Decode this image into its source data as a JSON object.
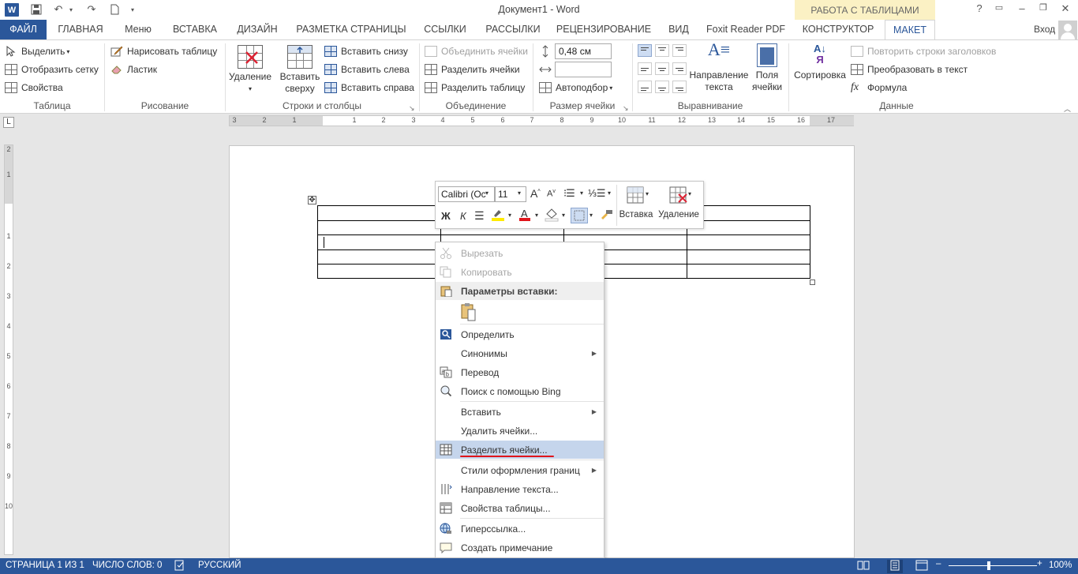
{
  "window": {
    "title": "Документ1 - Word",
    "context_group": "РАБОТА С ТАБЛИЦАМИ",
    "help": "?",
    "sign_in": "Вход"
  },
  "tabs": [
    {
      "label": "ФАЙЛ"
    },
    {
      "label": "ГЛАВНАЯ"
    },
    {
      "label": "Меню"
    },
    {
      "label": "ВСТАВКА"
    },
    {
      "label": "ДИЗАЙН"
    },
    {
      "label": "РАЗМЕТКА СТРАНИЦЫ"
    },
    {
      "label": "ССЫЛКИ"
    },
    {
      "label": "РАССЫЛКИ"
    },
    {
      "label": "РЕЦЕНЗИРОВАНИЕ"
    },
    {
      "label": "ВИД"
    },
    {
      "label": "Foxit Reader PDF"
    },
    {
      "label": "КОНСТРУКТОР"
    },
    {
      "label": "МАКЕТ"
    }
  ],
  "ribbon": {
    "table": {
      "label": "Таблица",
      "select": "Выделить",
      "show_grid": "Отобразить сетку",
      "properties": "Свойства"
    },
    "draw": {
      "label": "Рисование",
      "draw_table": "Нарисовать таблицу",
      "eraser": "Ластик"
    },
    "rows_cols": {
      "label": "Строки и столбцы",
      "delete": "Удаление",
      "insert_above_1": "Вставить",
      "insert_above_2": "сверху",
      "insert_below": "Вставить снизу",
      "insert_left": "Вставить слева",
      "insert_right": "Вставить справа"
    },
    "merge": {
      "label": "Объединение",
      "merge_cells": "Объединить ячейки",
      "split_cells": "Разделить ячейки",
      "split_table": "Разделить таблицу"
    },
    "cell_size": {
      "label": "Размер ячейки",
      "height": "0,48 см",
      "width": "",
      "autofit": "Автоподбор"
    },
    "alignment": {
      "label": "Выравнивание",
      "text_dir_1": "Направление",
      "text_dir_2": "текста",
      "margins_1": "Поля",
      "margins_2": "ячейки"
    },
    "data": {
      "label": "Данные",
      "sort": "Сортировка",
      "repeat_header": "Повторить строки заголовков",
      "convert": "Преобразовать в текст",
      "formula": "Формула"
    }
  },
  "ruler": {
    "h_numbers": [
      "3",
      "2",
      "1",
      "1",
      "2",
      "3",
      "4",
      "5",
      "6",
      "7",
      "8",
      "9",
      "10",
      "11",
      "12",
      "13",
      "14",
      "15",
      "16",
      "17"
    ],
    "v_numbers": [
      "2",
      "1",
      "1",
      "2",
      "3",
      "4",
      "5",
      "6",
      "7",
      "8",
      "9",
      "10"
    ]
  },
  "minibar": {
    "font": "Calibri (Ос",
    "size": "11",
    "bold": "Ж",
    "italic": "К",
    "insert": "Вставка",
    "delete": "Удаление"
  },
  "context_menu": {
    "cut": "Вырезать",
    "copy": "Копировать",
    "paste_options": "Параметры вставки:",
    "define": "Определить",
    "synonyms": "Синонимы",
    "translate": "Перевод",
    "bing_search": "Поиск с помощью Bing",
    "insert": "Вставить",
    "delete_cells": "Удалить ячейки...",
    "split_cells": "Разделить ячейки...",
    "border_styles": "Стили оформления границ",
    "text_direction": "Направление текста...",
    "table_properties": "Свойства таблицы...",
    "hyperlink": "Гиперссылка...",
    "add_comment": "Создать примечание"
  },
  "status": {
    "page": "СТРАНИЦА 1 ИЗ 1",
    "words": "ЧИСЛО СЛОВ: 0",
    "language": "РУССКИЙ",
    "zoom": "100%"
  },
  "colors": {
    "accent": "#2b579a",
    "highlight": "#c5d5ec",
    "underline": "#e0151b",
    "context_tab": "#fbf1c4"
  }
}
